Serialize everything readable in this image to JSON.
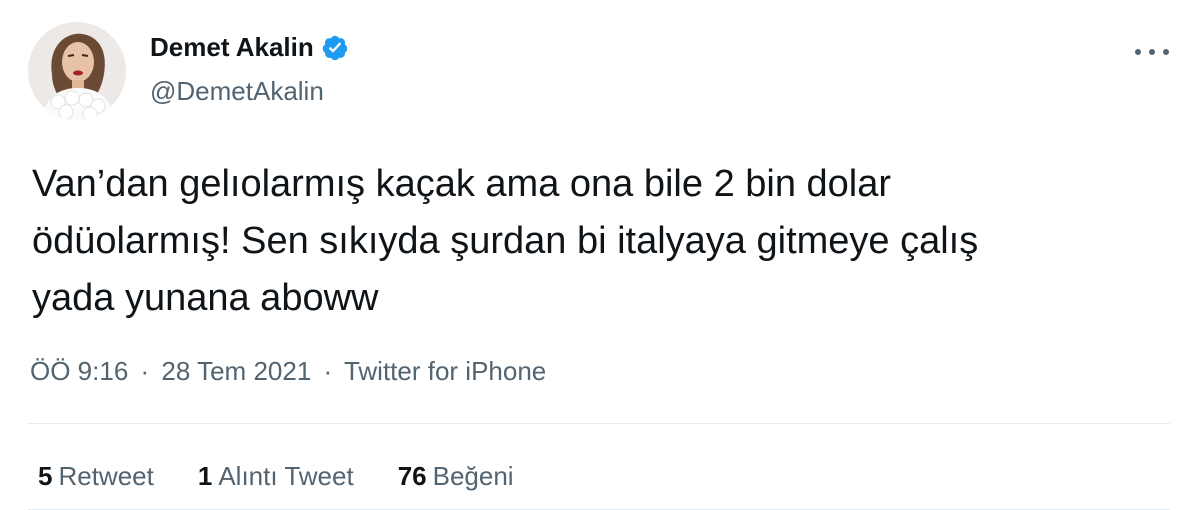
{
  "author": {
    "display_name": "Demet Akalin",
    "handle": "@DemetAkalin",
    "verified": true
  },
  "tweet": {
    "text": "Van’dan gelıolarmış kaçak ama ona bile 2 bin dolar\nödüolarmış! Sen sıkıyda şurdan bi italyaya gitmeye çalış\nyada yunana aboww",
    "time": "ÖÖ 9:16",
    "date": "28 Tem 2021",
    "source": "Twitter for iPhone",
    "separator": "·"
  },
  "stats": [
    {
      "count": "5",
      "label": "Retweet"
    },
    {
      "count": "1",
      "label": "Alıntı Tweet"
    },
    {
      "count": "76",
      "label": "Beğeni"
    }
  ],
  "colors": {
    "text_primary": "#0f1419",
    "text_secondary": "#536471",
    "verified_badge": "#1d9bf0",
    "divider": "#e6ecf0"
  },
  "icons": {
    "verified": "verified-badge-icon",
    "more": "more-options-icon"
  }
}
